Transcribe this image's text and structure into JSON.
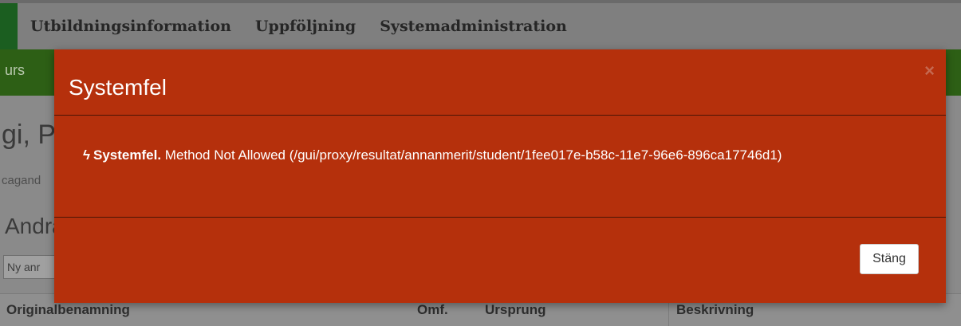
{
  "topnav": {
    "items": [
      "Utbildningsinformation",
      "Uppföljning",
      "Systemadministration"
    ]
  },
  "subnav": {
    "text": "urs"
  },
  "background": {
    "title": "gi, P",
    "subtitle": "cagand",
    "heading": "Andra",
    "new_button": "Ny anr",
    "table_headers": [
      "Originalbenamning",
      "Omf.",
      "Ursprung",
      "Beskrivning"
    ]
  },
  "modal": {
    "title": "Systemfel",
    "close_symbol": "×",
    "bolt_icon": "ϟ",
    "error_label": "Systemfel.",
    "error_message": "Method Not Allowed (/gui/proxy/resultat/annanmerit/student/1fee017e-b58c-11e7-96e6-896ca17746d1)",
    "close_button": "Stäng"
  },
  "colors": {
    "modal_bg": "#b5300c",
    "subnav_bg": "#2d5f15",
    "topnav_bg": "#7f7f7f"
  }
}
